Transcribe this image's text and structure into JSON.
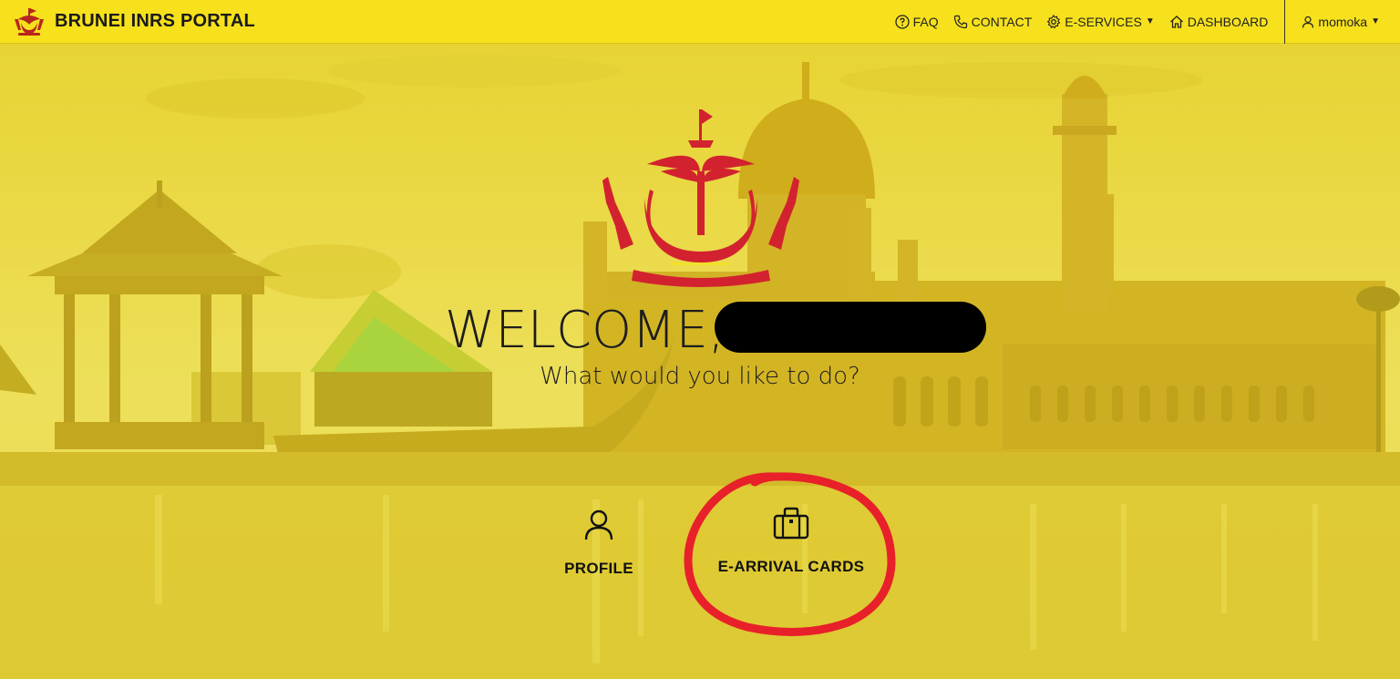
{
  "header": {
    "title": "BRUNEI INRS PORTAL",
    "nav": {
      "faq": "FAQ",
      "contact": "CONTACT",
      "eservices": "E-SERVICES",
      "dashboard": "DASHBOARD",
      "user": "momoka"
    }
  },
  "main": {
    "welcome": "WELCOME,",
    "subtitle": "What would you like to do?",
    "tiles": [
      {
        "label": "PROFILE",
        "icon": "user-icon"
      },
      {
        "label": "E-ARRIVAL CARDS",
        "icon": "briefcase-icon"
      }
    ]
  },
  "colors": {
    "navbar": "#f6e11c",
    "hero_tint": "#e9d83a",
    "crest": "#d0202e",
    "annotation": "#e8202a"
  }
}
